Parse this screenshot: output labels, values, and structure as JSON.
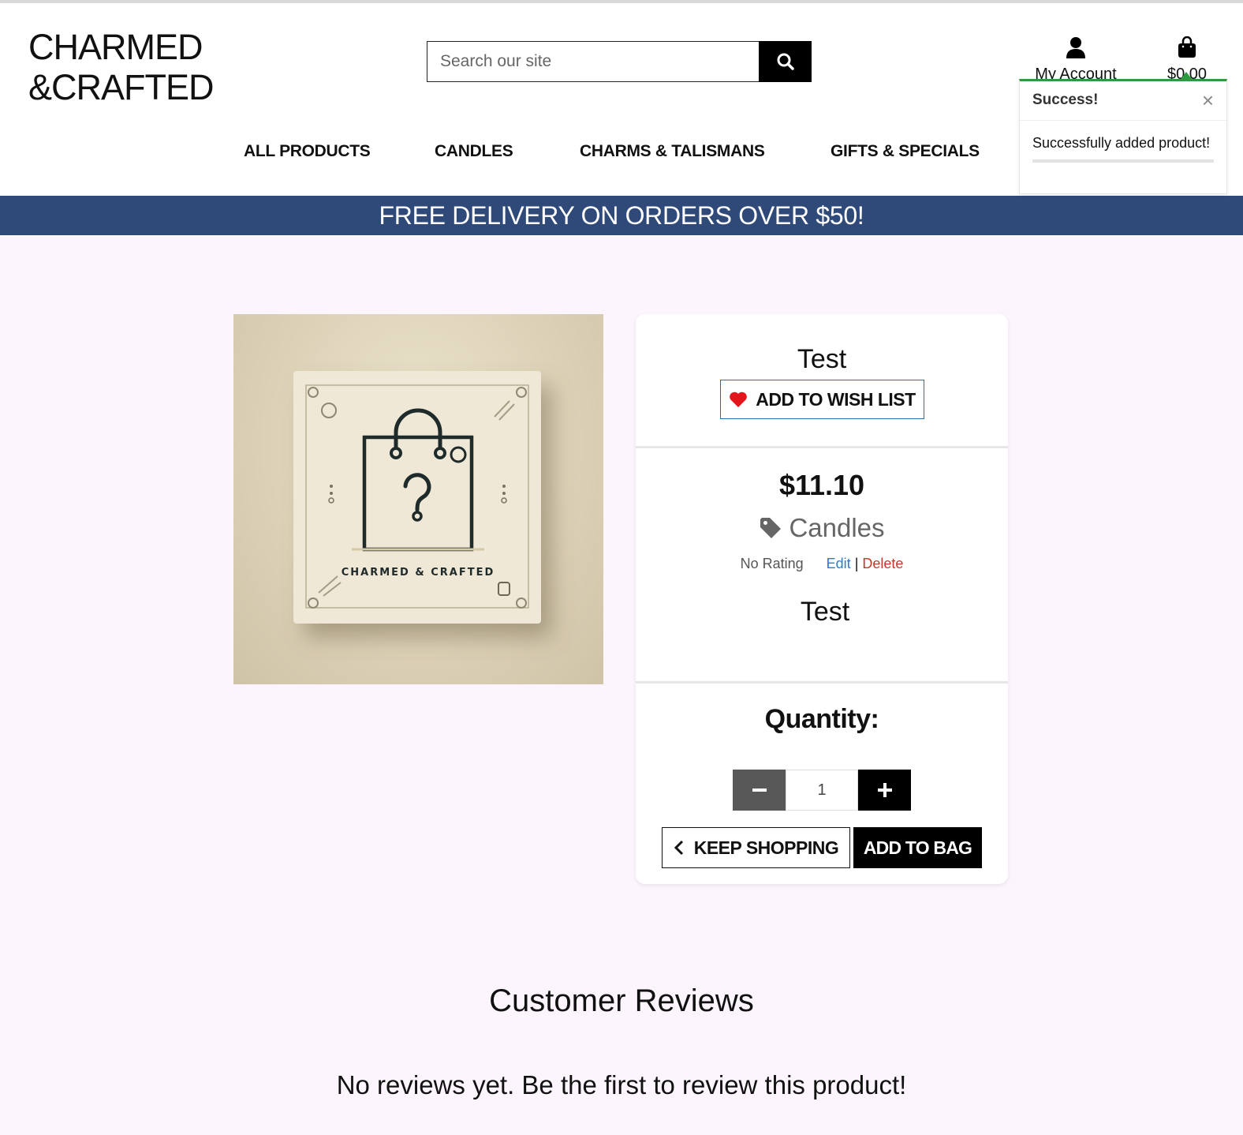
{
  "brand": {
    "line1": "CHARMED",
    "line2": "&CRAFTED"
  },
  "search": {
    "placeholder": "Search our site",
    "button_icon": "search-icon"
  },
  "account": {
    "label": "My Account",
    "icon": "user-icon"
  },
  "bag": {
    "total": "$0.00",
    "icon": "shopping-bag-icon"
  },
  "nav": {
    "items": [
      {
        "label": "ALL PRODUCTS"
      },
      {
        "label": "CANDLES"
      },
      {
        "label": "CHARMS & TALISMANS"
      },
      {
        "label": "GIFTS & SPECIALS"
      }
    ]
  },
  "toast": {
    "title": "Success!",
    "close": "×",
    "message": "Successfully added product!",
    "accent_color": "#2e9b3e"
  },
  "banner": {
    "text": "FREE DELIVERY ON ORDERS OVER $50!",
    "bg_color": "#2f4a78"
  },
  "product": {
    "image_text": "CHARMED & CRAFTED",
    "name": "Test",
    "wish_label": "ADD TO WISH LIST",
    "price": "$11.10",
    "category": "Candles",
    "rating": "No Rating",
    "edit_label": "Edit",
    "separator": "|",
    "delete_label": "Delete",
    "description": "Test",
    "quantity_label": "Quantity:",
    "quantity_value": "1",
    "keep_shopping_label": "KEEP SHOPPING",
    "add_to_bag_label": "ADD TO BAG"
  },
  "reviews": {
    "title": "Customer Reviews",
    "empty_text": "No reviews yet. Be the first to review this product!"
  }
}
